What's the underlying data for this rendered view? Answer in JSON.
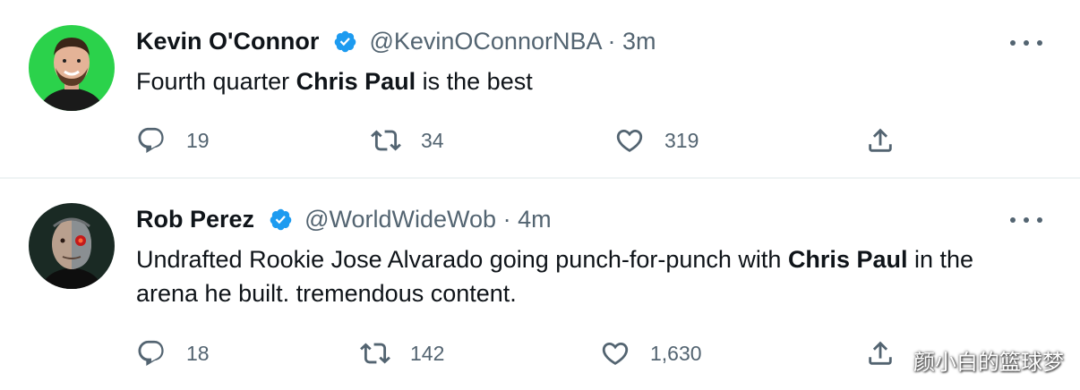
{
  "tweets": [
    {
      "name": "Kevin O'Connor",
      "handle": "@KevinOConnorNBA",
      "dot": "·",
      "time": "3m",
      "text_before": "Fourth quarter ",
      "text_bold": "Chris Paul",
      "text_after": " is the best",
      "replies": "19",
      "retweets": "34",
      "likes": "319"
    },
    {
      "name": "Rob Perez",
      "handle": "@WorldWideWob",
      "dot": "·",
      "time": "4m",
      "text_before": "Undrafted Rookie Jose Alvarado going punch-for-punch with ",
      "text_bold": "Chris Paul",
      "text_after": " in the arena he built. tremendous content.",
      "replies": "18",
      "retweets": "142",
      "likes": "1,630"
    }
  ],
  "watermark": "颜小白的篮球梦",
  "colors": {
    "verified": "#1d9bf0",
    "secondary_text": "#536471",
    "avatar1_bg": "#2bd24b"
  },
  "icons": [
    "verified-badge-icon",
    "more-icon",
    "reply-icon",
    "retweet-icon",
    "like-icon",
    "share-icon"
  ]
}
